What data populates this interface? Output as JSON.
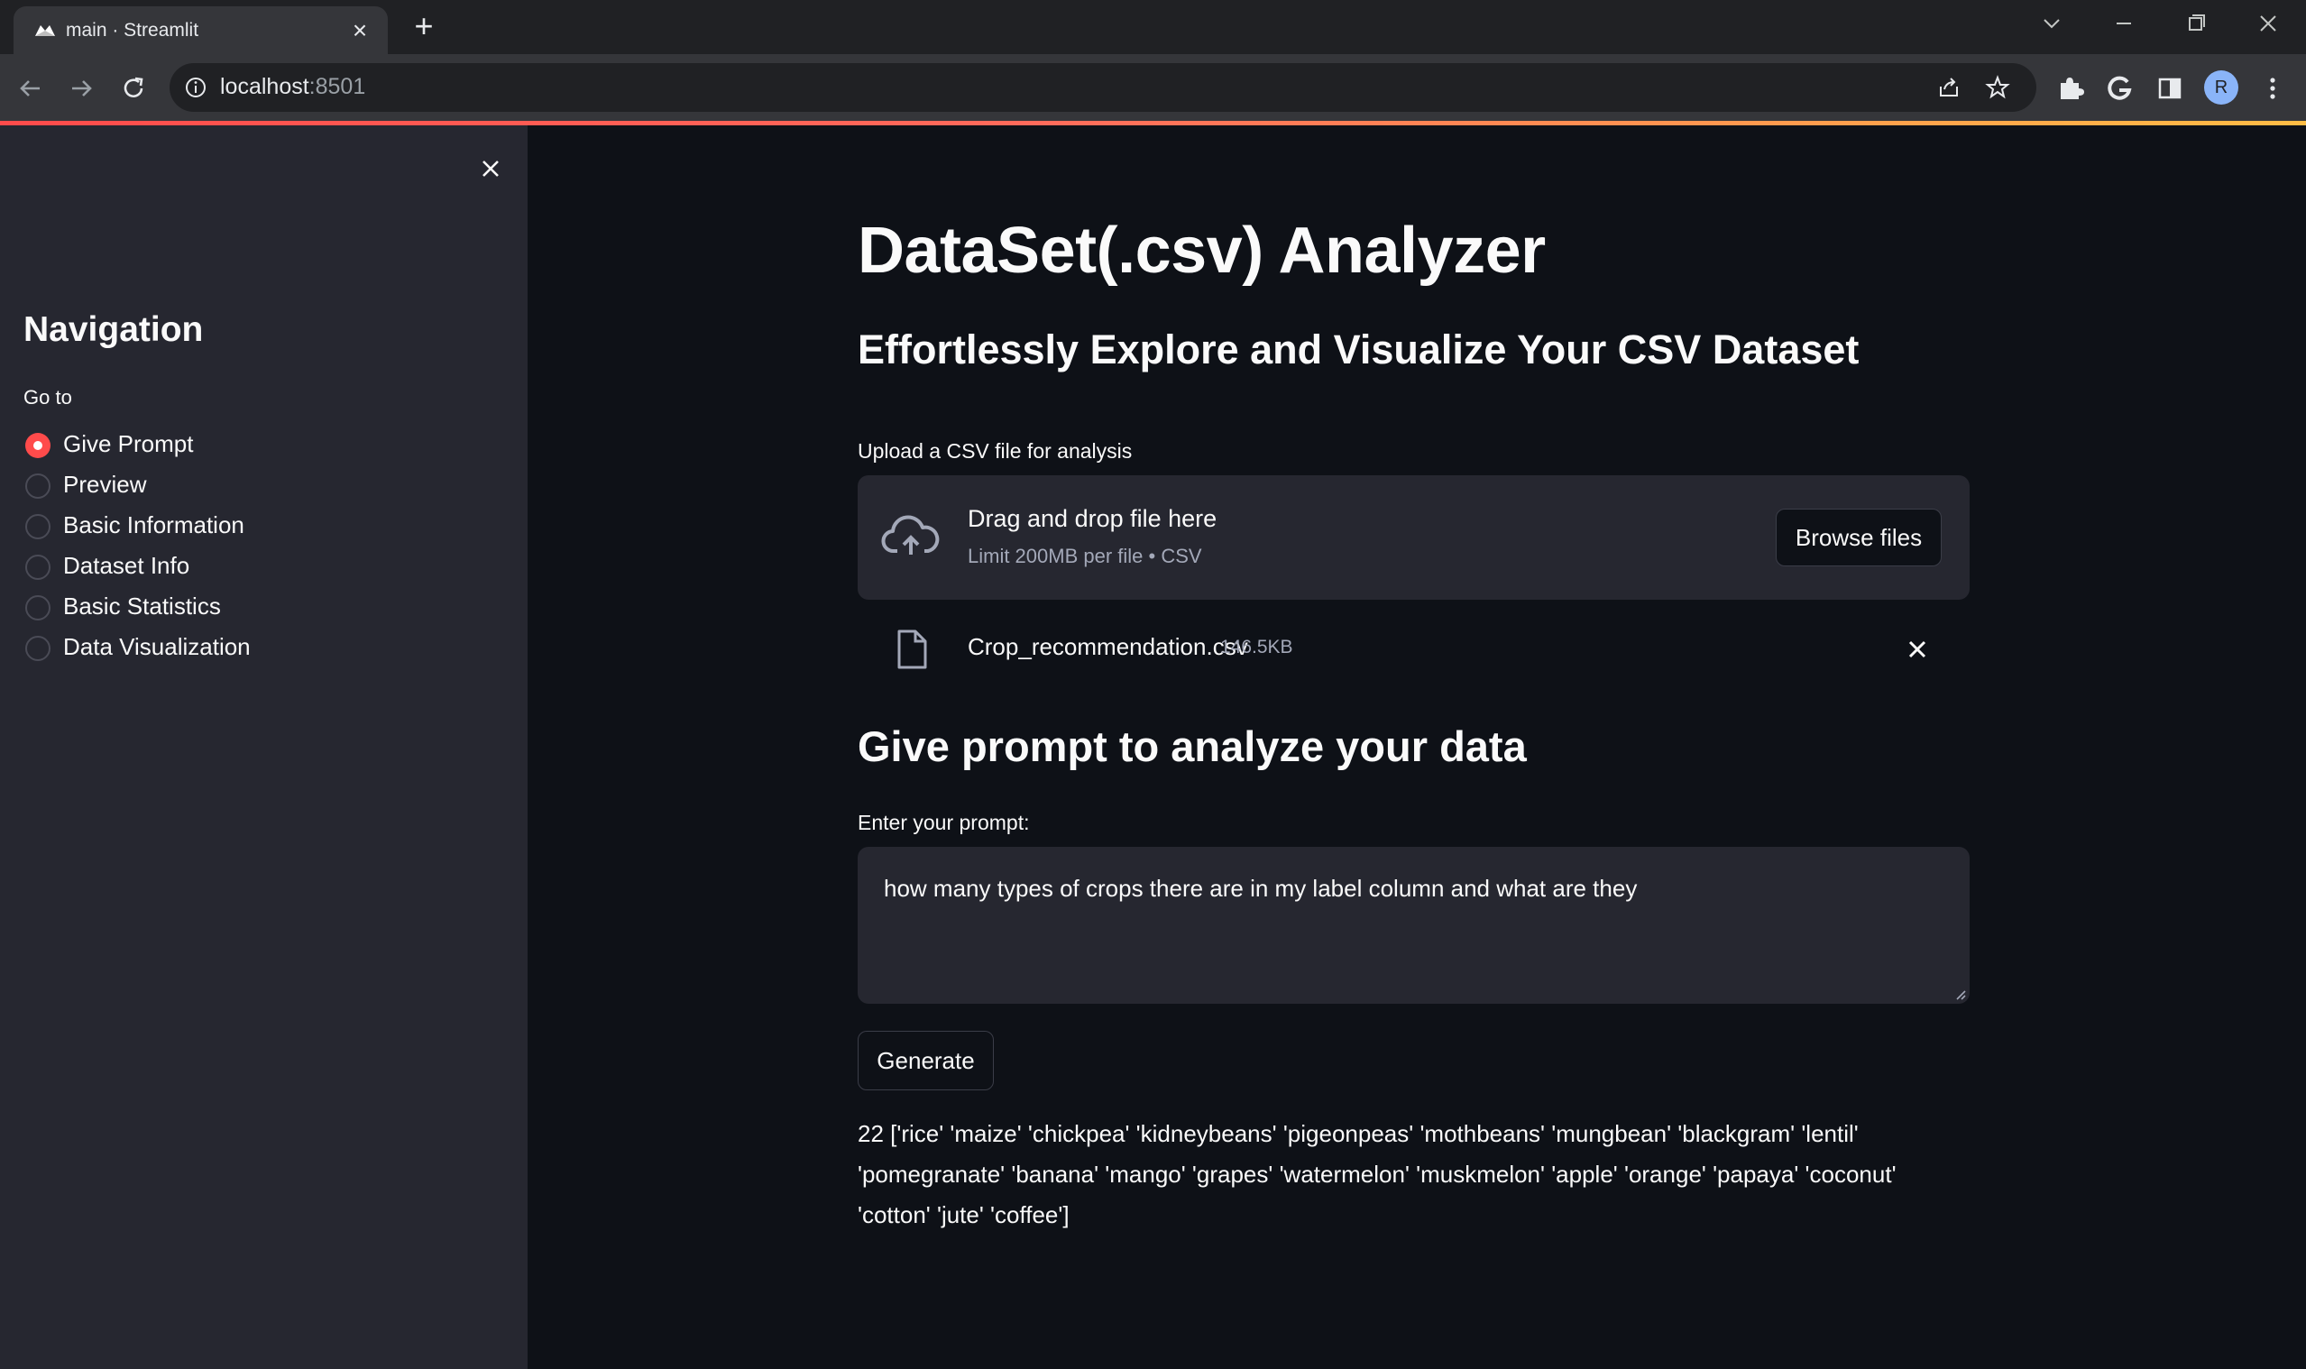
{
  "browser": {
    "tab_title": "main · Streamlit",
    "url_host": "localhost",
    "url_port": ":8501",
    "profile_initial": "R",
    "accent": "#ff4b4b"
  },
  "sidebar": {
    "title": "Navigation",
    "goto_label": "Go to",
    "items": [
      {
        "label": "Give Prompt",
        "selected": true
      },
      {
        "label": "Preview",
        "selected": false
      },
      {
        "label": "Basic Information",
        "selected": false
      },
      {
        "label": "Dataset Info",
        "selected": false
      },
      {
        "label": "Basic Statistics",
        "selected": false
      },
      {
        "label": "Data Visualization",
        "selected": false
      }
    ]
  },
  "main": {
    "title": "DataSet(.csv) Analyzer",
    "subtitle": "Effortlessly Explore and Visualize Your CSV Dataset",
    "upload": {
      "label": "Upload a CSV file for analysis",
      "dropzone_text": "Drag and drop file here",
      "limit_text": "Limit 200MB per file • CSV",
      "browse_label": "Browse files"
    },
    "file": {
      "name": "Crop_recommendation.csv",
      "size": "146.5KB"
    },
    "prompt_heading": "Give prompt to analyze your data",
    "prompt_label": "Enter your prompt:",
    "prompt_value": "how many types of crops there are in my label column and what are they",
    "generate_label": "Generate",
    "result_lines": [
      "22 ['rice' 'maize' 'chickpea' 'kidneybeans' 'pigeonpeas' 'mothbeans' 'mungbean' 'blackgram' 'lentil'",
      "'pomegranate' 'banana' 'mango' 'grapes' 'watermelon' 'muskmelon' 'apple' 'orange' 'papaya' 'coconut'",
      "'cotton' 'jute' 'coffee']"
    ]
  }
}
